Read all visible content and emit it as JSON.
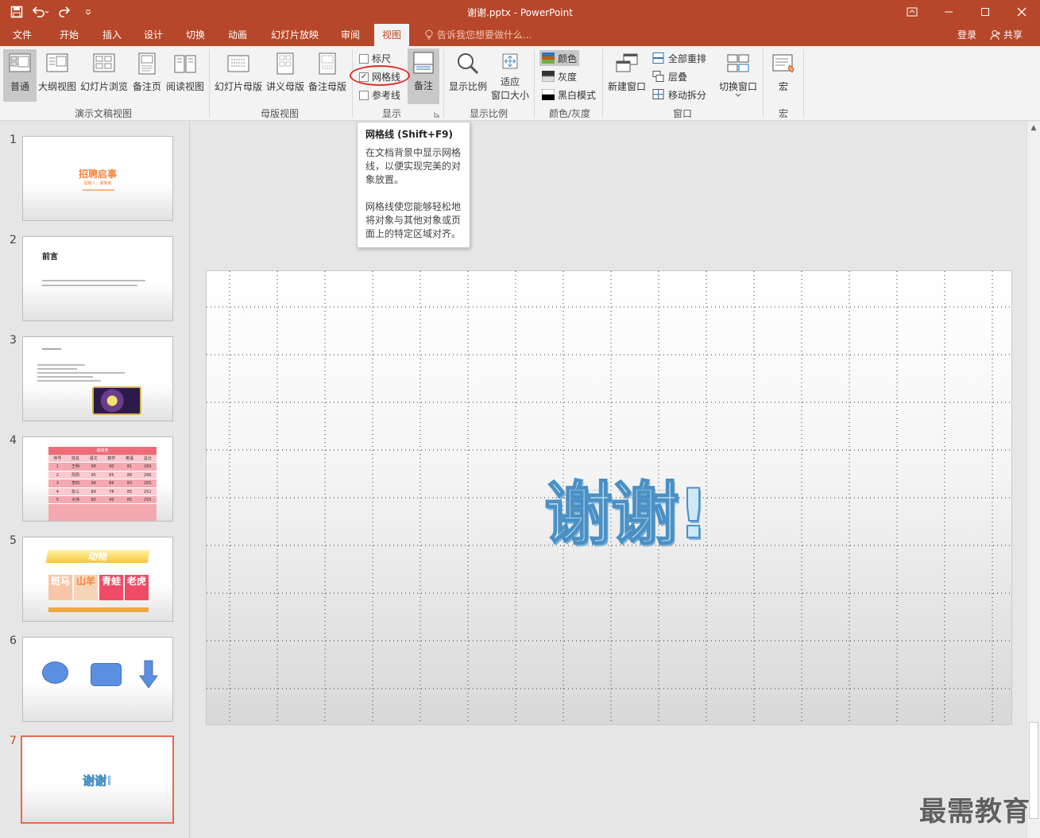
{
  "window": {
    "title": "谢谢.pptx - PowerPoint",
    "controls": [
      "ribbon-display-icon",
      "minimize-icon",
      "maximize-icon",
      "close-icon"
    ]
  },
  "tabs": [
    "文件",
    "开始",
    "插入",
    "设计",
    "切换",
    "动画",
    "幻灯片放映",
    "审阅",
    "视图"
  ],
  "active_tab": "视图",
  "tellme": "告诉我您想要做什么...",
  "signin": "登录",
  "share": "共享",
  "ribbon": {
    "presentation_views": {
      "label": "演示文稿视图",
      "buttons": [
        "普通",
        "大纲视图",
        "幻灯片浏览",
        "备注页",
        "阅读视图"
      ]
    },
    "master_views": {
      "label": "母版视图",
      "buttons": [
        "幻灯片母版",
        "讲义母版",
        "备注母版"
      ]
    },
    "show": {
      "label": "显示",
      "ruler": "标尺",
      "gridlines": "网格线",
      "guides": "参考线",
      "notes": "备注"
    },
    "zoom": {
      "label": "显示比例",
      "zoom_btn": "显示比例",
      "fit_line1": "适应",
      "fit_line2": "窗口大小"
    },
    "color": {
      "label": "颜色/灰度",
      "color": "颜色",
      "gray": "灰度",
      "bw": "黑白模式"
    },
    "window": {
      "label": "窗口",
      "new_window": "新建窗口",
      "arrange_all": "全部重排",
      "cascade": "层叠",
      "move_split": "移动拆分",
      "switch_window": "切换窗口"
    },
    "macros": {
      "label": "宏",
      "macro": "宏"
    }
  },
  "tooltip": {
    "title": "网格线 (Shift+F9)",
    "para1": "在文档背景中显示网格线，以便实现完美的对象放置。",
    "para2": "网格线使您能够轻松地将对象与其他对象或页面上的特定区域对齐。"
  },
  "slides": {
    "numbers": [
      "1",
      "2",
      "3",
      "4",
      "5",
      "6",
      "7"
    ],
    "s1": {
      "title": "招聘启事",
      "sub": "招聘人：某某某"
    },
    "s2": {
      "title": "前言"
    },
    "s4": {
      "title": "成绩表",
      "headers": [
        "序号",
        "姓名",
        "语文",
        "数学",
        "英语",
        "总分"
      ],
      "rows": [
        [
          "1",
          "王明",
          "98",
          "90",
          "81",
          "269"
        ],
        [
          "2",
          "周周",
          "95",
          "85",
          "86",
          "266"
        ],
        [
          "3",
          "李四",
          "98",
          "86",
          "83",
          "265"
        ],
        [
          "4",
          "张三",
          "89",
          "78",
          "85",
          "252"
        ],
        [
          "5",
          "大伟",
          "80",
          "90",
          "85",
          "255"
        ]
      ]
    },
    "s5": {
      "banner": "动物",
      "cells": [
        "斑马",
        "山羊",
        "青蛙",
        "老虎"
      ]
    },
    "s7": {
      "text": "谢谢!"
    }
  },
  "main_slide": {
    "text": "谢谢!"
  },
  "watermark": "最需教育"
}
